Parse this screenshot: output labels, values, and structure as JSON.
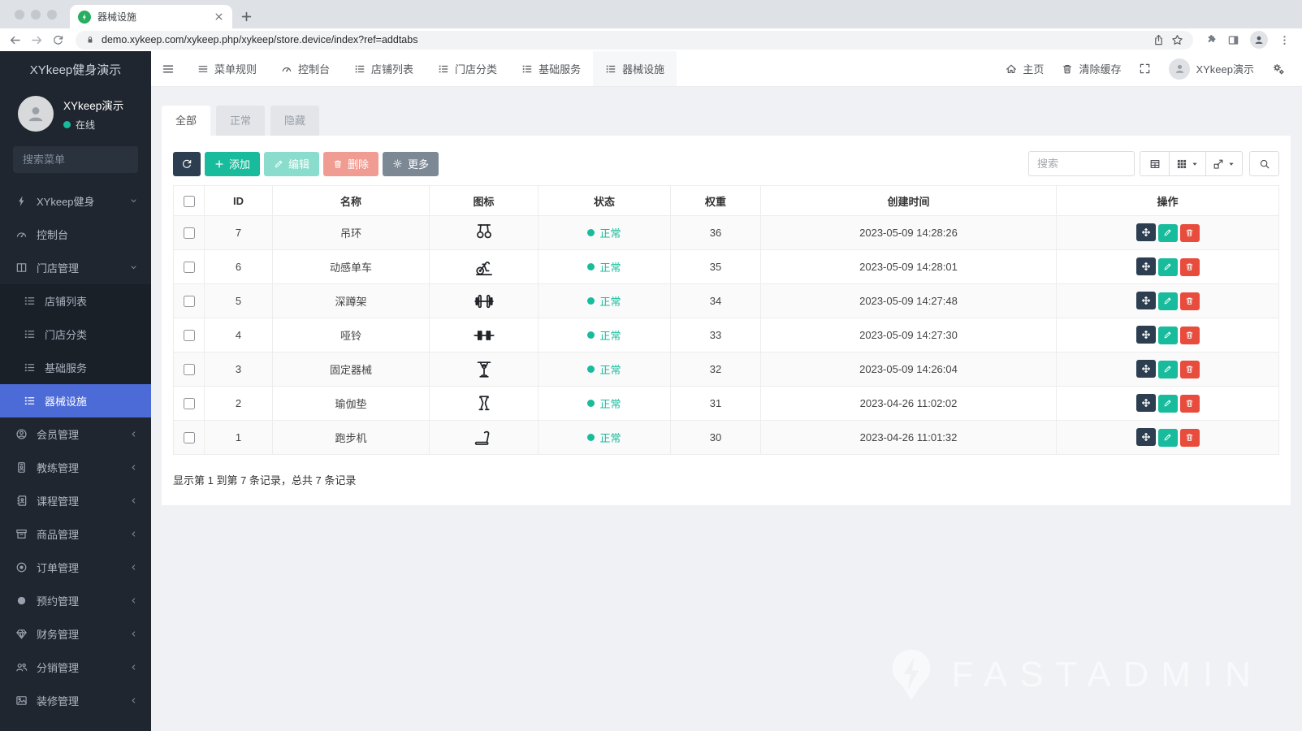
{
  "browser": {
    "tab_title": "器械设施",
    "url": "demo.xykeep.com/xykeep.php/xykeep/store.device/index?ref=addtabs"
  },
  "sidebar": {
    "brand": "XYkeep健身演示",
    "user": {
      "name": "XYkeep演示",
      "status": "在线"
    },
    "search_placeholder": "搜索菜单",
    "menu": [
      {
        "key": "xykeep-fitness",
        "label": "XYkeep健身",
        "icon": "bolt-icon",
        "arrow": "down"
      },
      {
        "key": "dashboard",
        "label": "控制台",
        "icon": "gauge-icon",
        "arrow": ""
      },
      {
        "key": "store-management",
        "label": "门店管理",
        "icon": "columns-icon",
        "arrow": "down"
      },
      {
        "key": "store-list",
        "label": "店铺列表",
        "icon": "list-icon",
        "type": "sub"
      },
      {
        "key": "store-category",
        "label": "门店分类",
        "icon": "list-icon",
        "type": "sub"
      },
      {
        "key": "basic-service",
        "label": "基础服务",
        "icon": "list-icon",
        "type": "sub"
      },
      {
        "key": "equipment",
        "label": "器械设施",
        "icon": "list-icon",
        "type": "sub",
        "active": true
      },
      {
        "key": "member",
        "label": "会员管理",
        "icon": "user-circle-icon",
        "arrow": "left"
      },
      {
        "key": "coach",
        "label": "教练管理",
        "icon": "id-badge-icon",
        "arrow": "left"
      },
      {
        "key": "course",
        "label": "课程管理",
        "icon": "address-book-icon",
        "arrow": "left"
      },
      {
        "key": "goods",
        "label": "商品管理",
        "icon": "archive-icon",
        "arrow": "left"
      },
      {
        "key": "order",
        "label": "订单管理",
        "icon": "dot-circle-icon",
        "arrow": "left"
      },
      {
        "key": "booking",
        "label": "预约管理",
        "icon": "circle-icon",
        "arrow": "left"
      },
      {
        "key": "finance",
        "label": "财务管理",
        "icon": "gem-icon",
        "arrow": "left"
      },
      {
        "key": "distribution",
        "label": "分销管理",
        "icon": "users-icon",
        "arrow": "left"
      },
      {
        "key": "decoration",
        "label": "装修管理",
        "icon": "image-icon",
        "arrow": "left"
      }
    ]
  },
  "topbar": {
    "tabs": [
      {
        "key": "menu-rules",
        "label": "菜单规则",
        "icon": "bars-icon"
      },
      {
        "key": "dashboard",
        "label": "控制台",
        "icon": "gauge-icon"
      },
      {
        "key": "store-list",
        "label": "店铺列表",
        "icon": "list-icon"
      },
      {
        "key": "store-category",
        "label": "门店分类",
        "icon": "list-icon"
      },
      {
        "key": "basic-service",
        "label": "基础服务",
        "icon": "list-icon"
      },
      {
        "key": "equipment",
        "label": "器械设施",
        "icon": "list-icon",
        "active": true
      }
    ],
    "home_label": "主页",
    "clear_cache_label": "清除缓存",
    "username": "XYkeep演示"
  },
  "filter_tabs": [
    {
      "label": "全部",
      "active": true
    },
    {
      "label": "正常"
    },
    {
      "label": "隐藏"
    }
  ],
  "toolbar": {
    "add_label": "添加",
    "edit_label": "编辑",
    "delete_label": "删除",
    "more_label": "更多",
    "search_placeholder": "搜索"
  },
  "table": {
    "columns": [
      "ID",
      "名称",
      "图标",
      "状态",
      "权重",
      "创建时间",
      "操作"
    ],
    "rows": [
      {
        "id": "7",
        "name": "吊环",
        "icon": "rings-icon",
        "status": "正常",
        "weight": "36",
        "created": "2023-05-09 14:28:26"
      },
      {
        "id": "6",
        "name": "动感单车",
        "icon": "spin-bike-icon",
        "status": "正常",
        "weight": "35",
        "created": "2023-05-09 14:28:01"
      },
      {
        "id": "5",
        "name": "深蹲架",
        "icon": "squat-rack-icon",
        "status": "正常",
        "weight": "34",
        "created": "2023-05-09 14:27:48"
      },
      {
        "id": "4",
        "name": "哑铃",
        "icon": "barbell-icon",
        "status": "正常",
        "weight": "33",
        "created": "2023-05-09 14:27:30"
      },
      {
        "id": "3",
        "name": "固定器械",
        "icon": "machine-icon",
        "status": "正常",
        "weight": "32",
        "created": "2023-05-09 14:26:04"
      },
      {
        "id": "2",
        "name": "瑜伽垫",
        "icon": "yoga-mat-icon",
        "status": "正常",
        "weight": "31",
        "created": "2023-04-26 11:02:02"
      },
      {
        "id": "1",
        "name": "跑步机",
        "icon": "treadmill-icon",
        "status": "正常",
        "weight": "30",
        "created": "2023-04-26 11:01:32"
      }
    ],
    "summary": "显示第 1 到第 7 条记录，总共 7 条记录"
  },
  "watermark": "FASTADMIN",
  "colors": {
    "accent_green": "#18bc9c",
    "primary_dark": "#2c3e50",
    "danger_red": "#e74c3c",
    "active_menu_blue": "#4d6bd6",
    "sidebar_bg": "#20262f",
    "favicon_green": "#27ae60"
  }
}
